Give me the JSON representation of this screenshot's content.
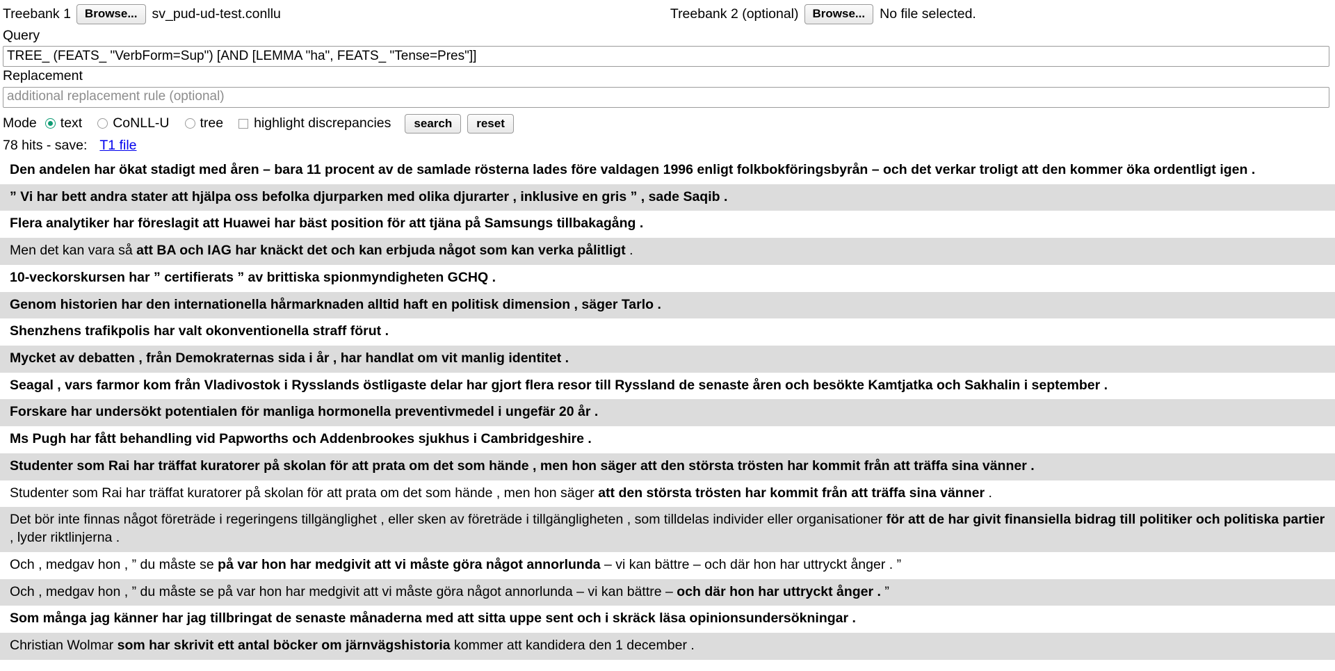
{
  "treebank1": {
    "label": "Treebank 1",
    "browse_label": "Browse...",
    "file_name": "sv_pud-ud-test.conllu"
  },
  "treebank2": {
    "label": "Treebank 2 (optional)",
    "browse_label": "Browse...",
    "file_name": "No file selected."
  },
  "query": {
    "label": "Query",
    "value": "TREE_ (FEATS_ \"VerbForm=Sup\") [AND [LEMMA \"ha\", FEATS_ \"Tense=Pres\"]]",
    "placeholder": ""
  },
  "replacement": {
    "label": "Replacement",
    "value": "",
    "placeholder": "additional replacement rule (optional)"
  },
  "mode": {
    "label": "Mode",
    "options": [
      {
        "label": "text",
        "selected": true
      },
      {
        "label": "CoNLL-U",
        "selected": false
      },
      {
        "label": "tree",
        "selected": false
      }
    ],
    "highlight_label": "highlight discrepancies",
    "highlight_checked": false,
    "search_label": "search",
    "reset_label": "reset"
  },
  "status": {
    "hits_text": "78 hits - save:",
    "save_link": "T1 file"
  },
  "colors": {
    "radio_accent": "#0d9b73",
    "link": "#0000ee",
    "row_alt_bg": "#dcdcdc",
    "row_bg": "#ffffff"
  },
  "results": [
    {
      "parts": [
        {
          "text": "Den andelen har ökat stadigt med åren – bara 11 procent av de samlade rösterna lades före valdagen 1996 enligt folkbokföringsbyrån – och det verkar troligt att den kommer öka ordentligt igen .",
          "bold": true
        }
      ]
    },
    {
      "parts": [
        {
          "text": "” Vi har bett andra stater att hjälpa oss befolka djurparken med olika djurarter , inklusive en gris ” , sade Saqib .",
          "bold": true
        }
      ]
    },
    {
      "parts": [
        {
          "text": "Flera analytiker har föreslagit att Huawei har bäst position för att tjäna på Samsungs tillbakagång .",
          "bold": true
        }
      ]
    },
    {
      "parts": [
        {
          "text": "Men det kan vara så ",
          "bold": false
        },
        {
          "text": "att BA och IAG har knäckt det och kan erbjuda något som kan verka pålitligt",
          "bold": true
        },
        {
          "text": " .",
          "bold": false
        }
      ]
    },
    {
      "parts": [
        {
          "text": "10-veckorskursen har ” certifierats ” av brittiska spionmyndigheten GCHQ .",
          "bold": true
        }
      ]
    },
    {
      "parts": [
        {
          "text": "Genom historien har den internationella hårmarknaden alltid haft en politisk dimension , säger Tarlo .",
          "bold": true
        }
      ]
    },
    {
      "parts": [
        {
          "text": "Shenzhens trafikpolis har valt okonventionella straff förut .",
          "bold": true
        }
      ]
    },
    {
      "parts": [
        {
          "text": "Mycket av debatten , från Demokraternas sida i år , har handlat om vit manlig identitet .",
          "bold": true
        }
      ]
    },
    {
      "parts": [
        {
          "text": "Seagal , vars farmor kom från Vladivostok i Rysslands östligaste delar har gjort flera resor till Ryssland de senaste åren och besökte Kamtjatka och Sakhalin i september .",
          "bold": true
        }
      ]
    },
    {
      "parts": [
        {
          "text": "Forskare har undersökt potentialen för manliga hormonella preventivmedel i ungefär 20 år .",
          "bold": true
        }
      ]
    },
    {
      "parts": [
        {
          "text": "Ms Pugh har fått behandling vid Papworths och Addenbrookes sjukhus i Cambridgeshire .",
          "bold": true
        }
      ]
    },
    {
      "parts": [
        {
          "text": "Studenter som Rai har träffat kuratorer på skolan för att prata om det som hände , men hon säger att den största trösten har kommit från att träffa sina vänner .",
          "bold": true
        }
      ]
    },
    {
      "parts": [
        {
          "text": "Studenter som Rai har träffat kuratorer på skolan för att prata om det som hände , men hon säger ",
          "bold": false
        },
        {
          "text": "att den största trösten har kommit från att träffa sina vänner",
          "bold": true
        },
        {
          "text": " .",
          "bold": false
        }
      ]
    },
    {
      "parts": [
        {
          "text": "Det bör inte finnas något företräde i regeringens tillgänglighet , eller sken av företräde i tillgängligheten , som tilldelas individer eller organisationer ",
          "bold": false
        },
        {
          "text": "för att de har givit finansiella bidrag till politiker och politiska partier",
          "bold": true
        },
        {
          "text": " , lyder riktlinjerna .",
          "bold": false
        }
      ]
    },
    {
      "parts": [
        {
          "text": "Och , medgav hon , ” du måste se ",
          "bold": false
        },
        {
          "text": "på var hon har medgivit att vi måste göra något annorlunda",
          "bold": true
        },
        {
          "text": " – vi kan bättre – och där hon har uttryckt ånger . ”",
          "bold": false
        }
      ]
    },
    {
      "parts": [
        {
          "text": "Och , medgav hon , ” du måste se på var hon har medgivit att vi måste göra något annorlunda – vi kan bättre – ",
          "bold": false
        },
        {
          "text": "och där hon har uttryckt ånger .",
          "bold": true
        },
        {
          "text": " ”",
          "bold": false
        }
      ]
    },
    {
      "parts": [
        {
          "text": "Som många jag känner har jag tillbringat de senaste månaderna med att sitta uppe sent och i skräck läsa opinionsundersökningar .",
          "bold": true
        }
      ]
    },
    {
      "parts": [
        {
          "text": "Christian Wolmar ",
          "bold": false
        },
        {
          "text": "som har skrivit ett antal böcker om järnvägshistoria",
          "bold": true
        },
        {
          "text": " kommer att kandidera den 1 december .",
          "bold": false
        }
      ]
    }
  ]
}
